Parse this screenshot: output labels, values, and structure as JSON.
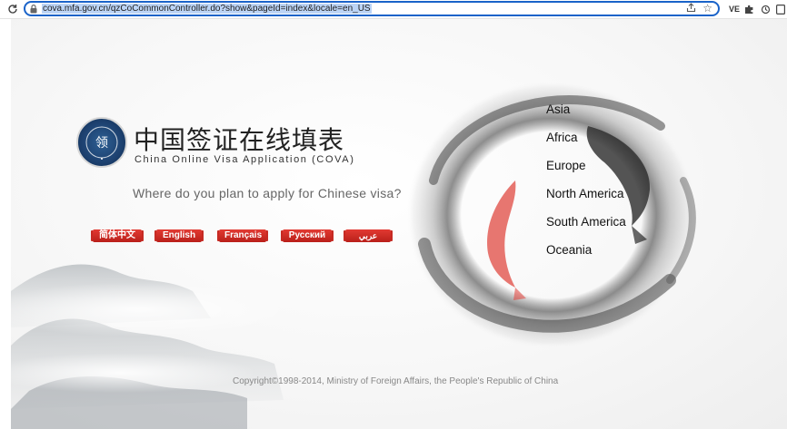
{
  "browser": {
    "url": "cova.mfa.gov.cn/qzCoCommonController.do?show&pageId=index&locale=en_US",
    "reload_icon": "reload-icon",
    "lock_icon": "lock-icon",
    "share_icon": "share-icon",
    "star_icon": "star-icon",
    "extensions": [
      {
        "name": "extension-ve-icon",
        "glyph": "VE"
      },
      {
        "name": "extension-star-icon",
        "glyph": "★"
      },
      {
        "name": "extensions-puzzle-icon",
        "glyph": "✱"
      },
      {
        "name": "extension-refresh-icon",
        "glyph": "⟳"
      },
      {
        "name": "side-panel-icon",
        "glyph": "▢"
      }
    ]
  },
  "site": {
    "title_cn": "中国签证在线填表",
    "title_en": "China Online Visa Application (COVA)",
    "question": "Where do you plan to apply for Chinese visa?",
    "languages": [
      {
        "label": "简体中文"
      },
      {
        "label": "English"
      },
      {
        "label": "Français"
      },
      {
        "label": "Русский"
      },
      {
        "label": "عربي"
      }
    ],
    "regions": [
      {
        "label": "Asia"
      },
      {
        "label": "Africa"
      },
      {
        "label": "Europe"
      },
      {
        "label": "North America"
      },
      {
        "label": "South America"
      },
      {
        "label": "Oceania"
      }
    ],
    "copyright": "Copyright©1998-2014, Ministry of Foreign Affairs, the People's Republic of China"
  },
  "colors": {
    "accent_red": "#c62a23",
    "address_border": "#1a63c9",
    "url_highlight": "#bcd4f5"
  }
}
